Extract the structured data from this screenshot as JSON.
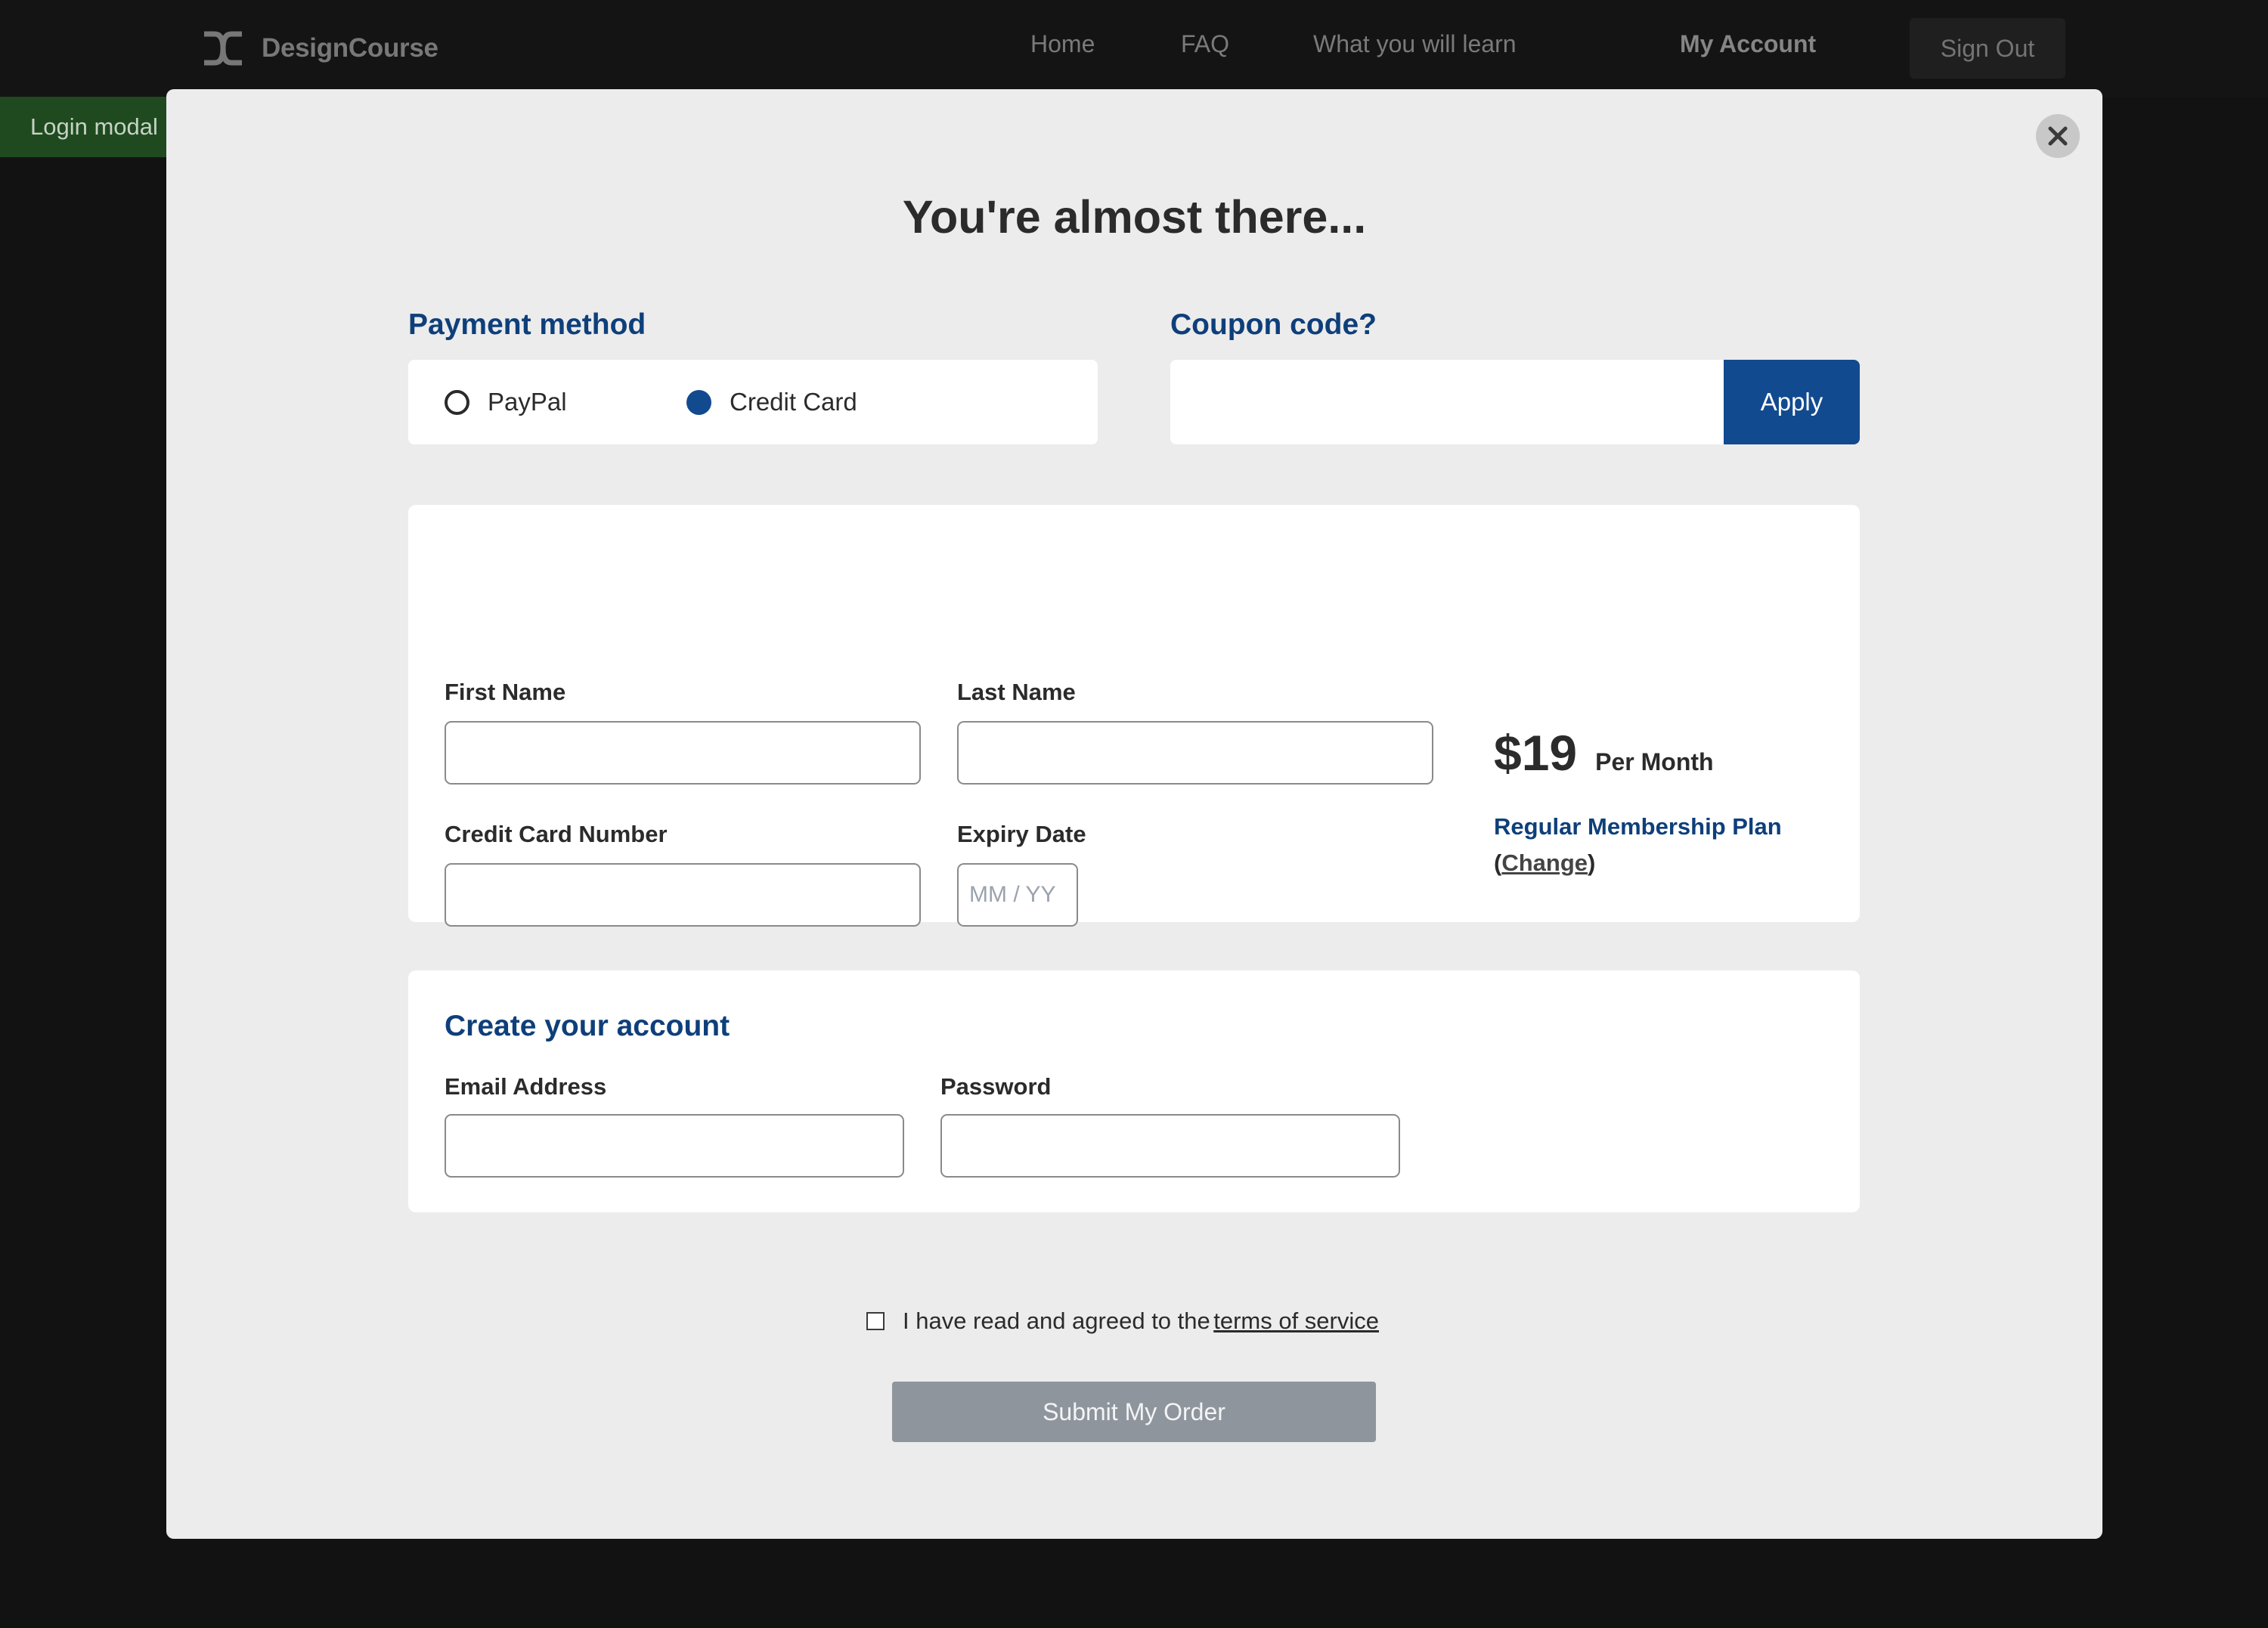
{
  "nav": {
    "brand": "DesignCourse",
    "brand_icon": "designcourse-logo-icon",
    "links": [
      "Home",
      "FAQ",
      "What you will learn",
      "My Account"
    ],
    "sign_out": "Sign Out"
  },
  "side_tab": {
    "label": "Login modal"
  },
  "modal": {
    "close_icon": "close-icon",
    "title": "You're almost there...",
    "payment": {
      "heading": "Payment method",
      "options": [
        {
          "label": "PayPal",
          "selected": false
        },
        {
          "label": "Credit Card",
          "selected": true
        }
      ]
    },
    "coupon": {
      "heading": "Coupon code?",
      "value": "",
      "apply_label": "Apply"
    },
    "card": {
      "first_name_label": "First Name",
      "last_name_label": "Last Name",
      "card_number_label": "Credit Card Number",
      "expiry_label": "Expiry Date",
      "expiry_placeholder": "MM / YY"
    },
    "plan": {
      "price": "$19",
      "period": "Per Month",
      "name": "Regular Membership Plan",
      "change_open": "(",
      "change_label": "Change",
      "change_close": ")"
    },
    "account": {
      "heading": "Create your account",
      "email_label": "Email Address",
      "password_label": "Password"
    },
    "terms": {
      "checked": false,
      "text": "I have read and agreed to the",
      "link": "terms of service"
    },
    "submit_label": "Submit My Order"
  },
  "colors": {
    "accent": "#114a8f",
    "heading_blue": "#0e3f7a",
    "overlay": "#121212",
    "modal_bg": "#ececec",
    "submit_disabled": "#8f959c",
    "login_tab": "#1f4a1f"
  }
}
